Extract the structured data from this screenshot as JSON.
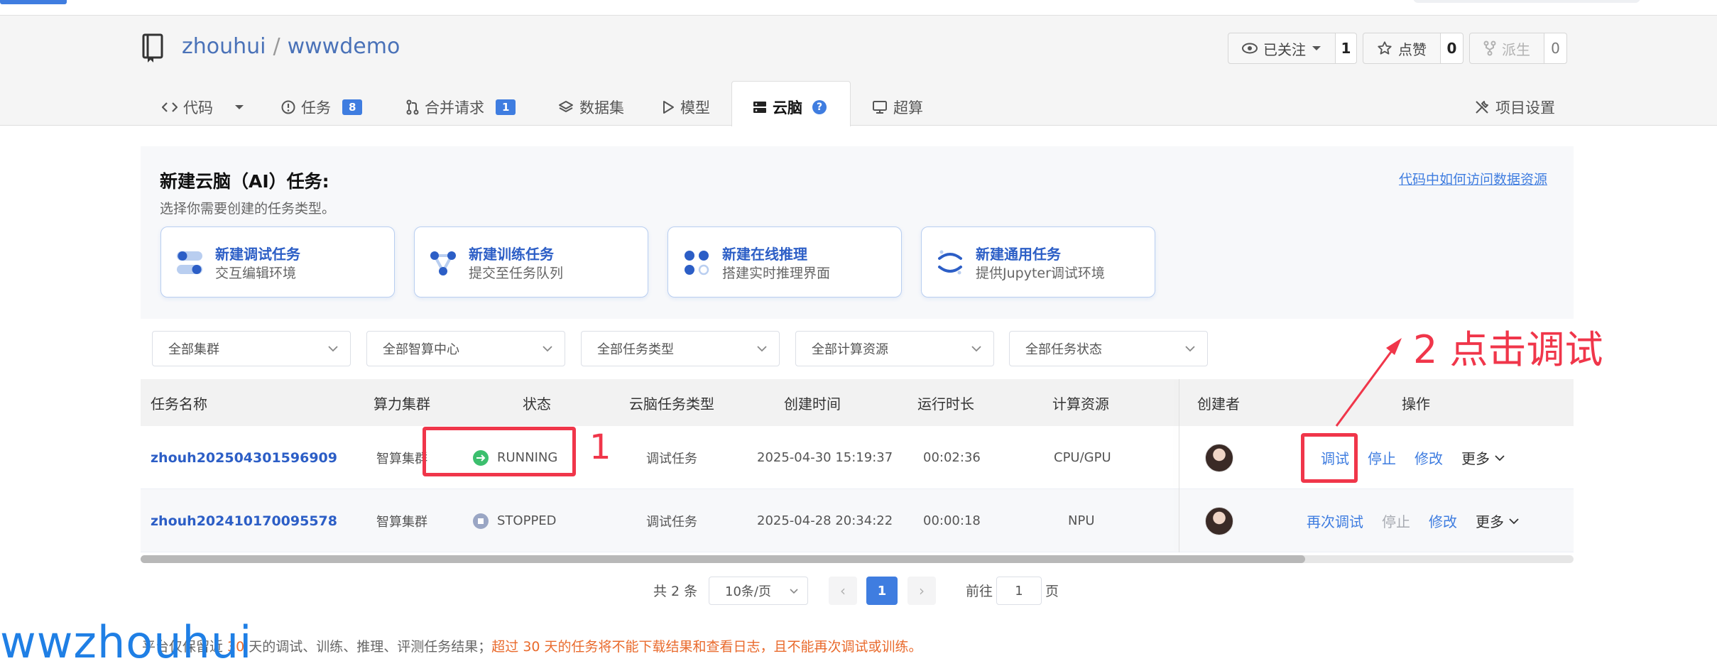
{
  "repo": {
    "owner": "zhouhui",
    "separator": "/",
    "name": "wwwdemo"
  },
  "header_actions": {
    "watch": {
      "label": "已关注",
      "count": "1"
    },
    "star": {
      "label": "点赞",
      "count": "0"
    },
    "fork": {
      "label": "派生",
      "count": "0"
    }
  },
  "tabs": [
    {
      "label": "代码"
    },
    {
      "label": "任务",
      "badge": "8"
    },
    {
      "label": "合并请求",
      "badge": "1"
    },
    {
      "label": "数据集"
    },
    {
      "label": "模型"
    },
    {
      "label": "云脑",
      "help": "?"
    },
    {
      "label": "超算"
    }
  ],
  "project_settings": "项目设置",
  "create": {
    "title": "新建云脑（AI）任务:",
    "subtitle": "选择你需要创建的任务类型。",
    "help_link": "代码中如何访问数据资源",
    "cards": [
      {
        "title": "新建调试任务",
        "desc": "交互编辑环境"
      },
      {
        "title": "新建训练任务",
        "desc": "提交至任务队列"
      },
      {
        "title": "新建在线推理",
        "desc": "搭建实时推理界面"
      },
      {
        "title": "新建通用任务",
        "desc": "提供Jupyter调试环境"
      }
    ]
  },
  "filters": [
    "全部集群",
    "全部智算中心",
    "全部任务类型",
    "全部计算资源",
    "全部任务状态"
  ],
  "table": {
    "headers": [
      "任务名称",
      "算力集群",
      "状态",
      "云脑任务类型",
      "创建时间",
      "运行时长",
      "计算资源",
      "创建者",
      "操作"
    ],
    "rows": [
      {
        "name": "zhouh202504301596909",
        "cluster": "智算集群",
        "status": "RUNNING",
        "type": "调试任务",
        "created": "2025-04-30 15:19:37",
        "duration": "00:02:36",
        "resource": "CPU/GPU",
        "ops": {
          "primary": "调试",
          "stop": "停止",
          "edit": "修改",
          "more": "更多"
        }
      },
      {
        "name": "zhouh202410170095578",
        "cluster": "智算集群",
        "status": "STOPPED",
        "type": "调试任务",
        "created": "2025-04-28 20:34:22",
        "duration": "00:00:18",
        "resource": "NPU",
        "ops": {
          "primary": "再次调试",
          "stop": "停止",
          "edit": "修改",
          "more": "更多"
        }
      }
    ]
  },
  "pagination": {
    "total": "共 2 条",
    "page_size": "10条/页",
    "current": "1",
    "goto": "前往",
    "goto_value": "1",
    "unit": "页",
    "prev": "‹",
    "next": "›"
  },
  "footer_note": {
    "part1": "平台仅保留近 ",
    "days1": "30",
    "part2": " 天的调试、训练、推理、评测任务结果；",
    "warn": "超过 30 天的任务将不能下载结果和查看日志，且不能再次调试或训练。"
  },
  "annotations": {
    "step1": "1",
    "step2": "2 点击调试"
  },
  "watermark": "wwzhouhui",
  "colors": {
    "accent": "#3f7de0",
    "annotation": "#f0364a",
    "running": "#3cbf6e",
    "stopped": "#9aa6c4",
    "warning": "#e96a2c"
  }
}
